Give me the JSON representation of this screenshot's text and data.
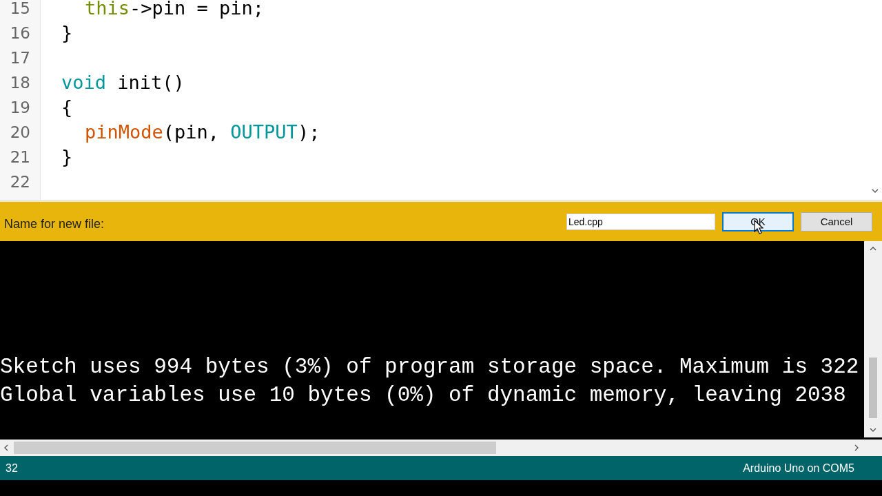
{
  "editor": {
    "lines": [
      {
        "number": "15",
        "indented": true,
        "tokens": [
          {
            "kind": "this",
            "text": "this"
          },
          {
            "kind": "plain",
            "text": "->pin = pin;"
          }
        ]
      },
      {
        "number": "16",
        "indented": false,
        "tokens": [
          {
            "kind": "plain",
            "text": "}"
          }
        ]
      },
      {
        "number": "17"
      },
      {
        "number": "18",
        "indented": false,
        "tokens": [
          {
            "kind": "keyword",
            "text": "void"
          },
          {
            "kind": "plain",
            "text": " init()"
          }
        ]
      },
      {
        "number": "19",
        "indented": false,
        "tokens": [
          {
            "kind": "plain",
            "text": "{"
          }
        ]
      },
      {
        "number": "20",
        "indented": true,
        "tokens": [
          {
            "kind": "function",
            "text": "pinMode"
          },
          {
            "kind": "plain",
            "text": "(pin, "
          },
          {
            "kind": "keyword",
            "text": "OUTPUT"
          },
          {
            "kind": "plain",
            "text": ");"
          }
        ]
      },
      {
        "number": "21",
        "indented": false,
        "tokens": [
          {
            "kind": "plain",
            "text": "}"
          }
        ]
      },
      {
        "number": "22"
      }
    ]
  },
  "prompt": {
    "label": "Name for new file:",
    "value": "Led.cpp",
    "buttons": [
      {
        "label": "OK",
        "focused": true
      },
      {
        "label": "Cancel",
        "focused": false
      }
    ]
  },
  "console": {
    "lines": [
      "Sketch uses 994 bytes (3%) of program storage space. Maximum is 322",
      "Global variables use 10 bytes (0%) of dynamic memory, leaving 2038"
    ]
  },
  "status_bar": {
    "line": "32",
    "board": "Arduino Uno on COM5"
  }
}
